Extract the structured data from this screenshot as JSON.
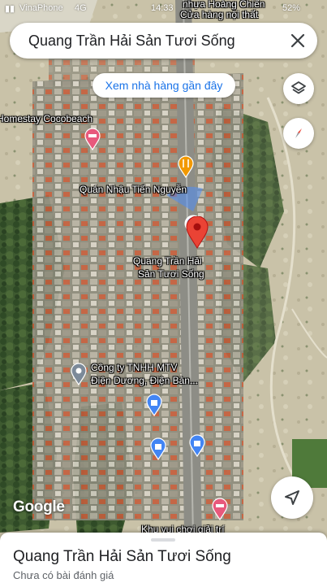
{
  "status_bar": {
    "carrier": "VinaPhone",
    "network": "4G",
    "time": "14:33",
    "battery": "52%"
  },
  "search": {
    "query": "Quang Trần Hải Sản Tươi Sống",
    "close_icon": "close-icon"
  },
  "chip": {
    "label": "Xem nhà hàng gần đây"
  },
  "buttons": {
    "layers_icon": "layers-icon",
    "compass_icon": "compass-icon",
    "navigate_icon": "navigation-arrow-icon"
  },
  "map_labels": {
    "hoang_chien": "nhựa Hoàng Chiến",
    "cua_hang": "Cửa hàng nội thất",
    "homestay": "Homestay Cocobeach",
    "quan_nhau": "Quán Nhậu Tiến Nguyễn",
    "selected_line1": "Quang Trần Hải",
    "selected_line2": "Sản Tươi Sống",
    "company_line1": "Công ty TNHH MTV",
    "company_line2": "Điện Dương, Điện Bàn...",
    "bottom_partial": "Khu vui chơi giải trí"
  },
  "google_logo": "Google",
  "colors": {
    "selected_pin": "#ea4335",
    "food_pin": "#f29900",
    "shop_pin": "#4285f4",
    "hotel_pin": "#e8597c",
    "link_blue": "#1a73e8"
  },
  "sheet": {
    "title": "Quang Trần Hải Sản Tươi Sống",
    "subtitle": "Chưa có bài đánh giá"
  }
}
